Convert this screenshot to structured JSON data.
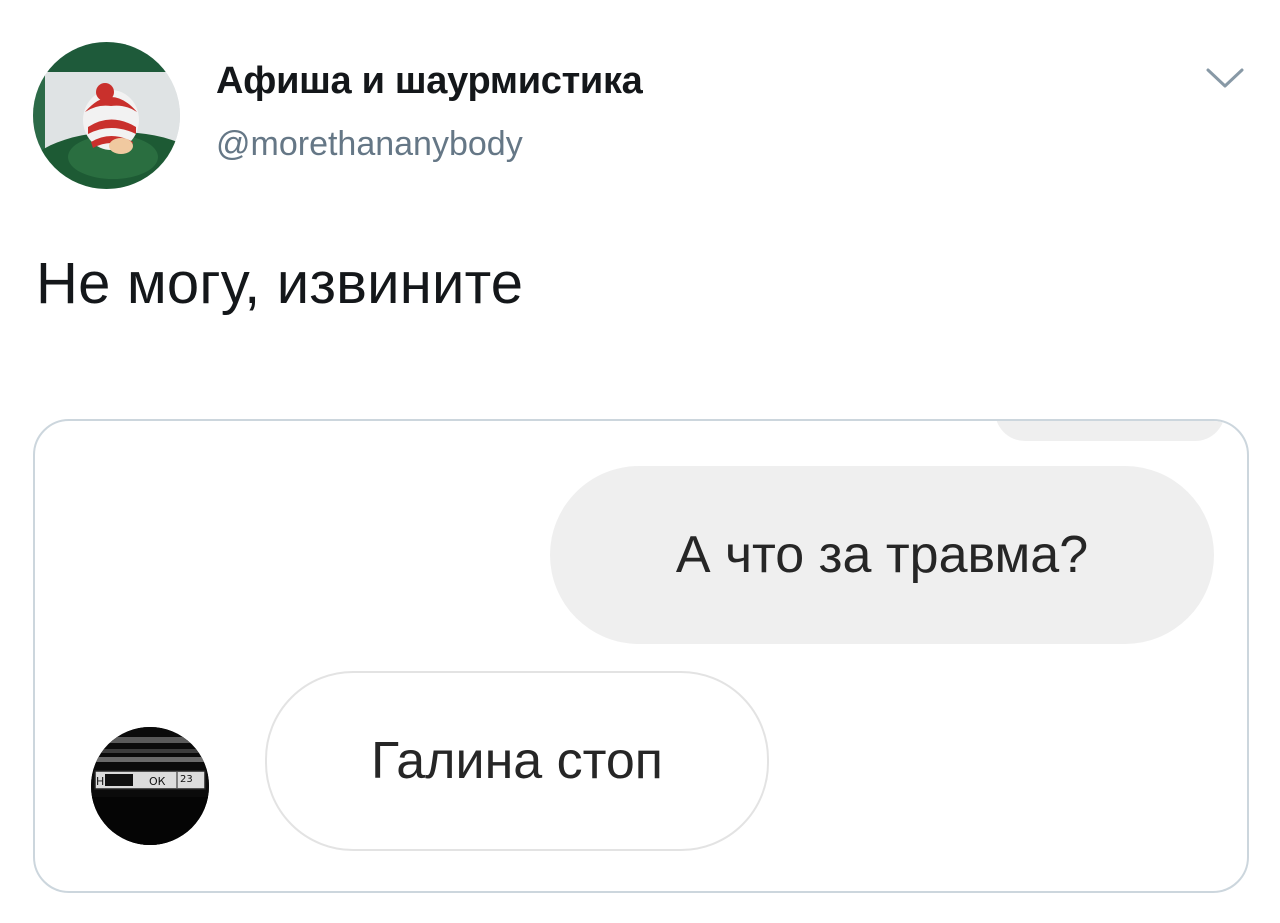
{
  "tweet": {
    "display_name": "Афиша и шаурмистика",
    "handle": "@morethananybody",
    "text": "Не могу, извините",
    "avatar_icon": "cartoon-character-avatar",
    "menu_icon": "chevron-down-icon"
  },
  "media": {
    "messages": [
      {
        "direction": "outgoing",
        "text": "А что за травма?"
      },
      {
        "direction": "incoming",
        "text": "Галина стоп"
      }
    ],
    "sender_avatar_icon": "car-license-plate-avatar",
    "plate_text": "Н  ОК 23"
  },
  "colors": {
    "handle": "#657786",
    "outgoing_bubble": "#efefef",
    "card_border": "#ccd6dd"
  }
}
